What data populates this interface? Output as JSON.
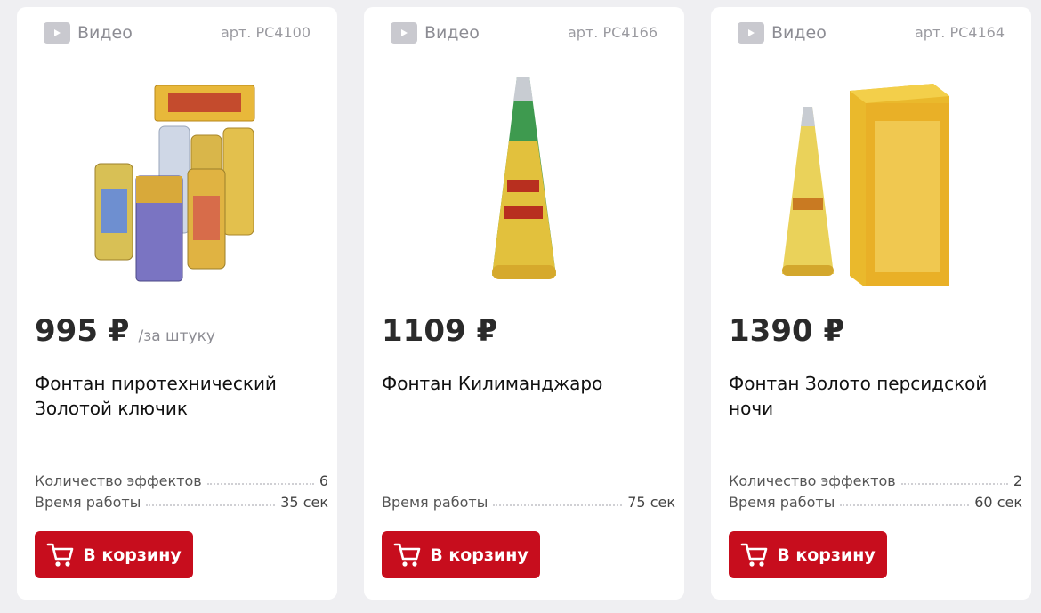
{
  "products": [
    {
      "video_label": "Видео",
      "sku": "арт. PC4100",
      "price": "995 ₽",
      "price_unit": "/за штуку",
      "title": "Фонтан пиротехнический Золотой ключик",
      "specs": [
        {
          "label": "Количество эффектов",
          "value": "6"
        },
        {
          "label": "Время работы",
          "value": "35 сек"
        }
      ],
      "cart_label": "В корзину"
    },
    {
      "video_label": "Видео",
      "sku": "арт. PC4166",
      "price": "1109 ₽",
      "title": "Фонтан Килиманджаро",
      "specs": [
        {
          "label": "Время работы",
          "value": "75 сек"
        }
      ],
      "cart_label": "В корзину"
    },
    {
      "video_label": "Видео",
      "sku": "арт. PC4164",
      "price": "1390 ₽",
      "title": "Фонтан Золото персидской ночи",
      "specs": [
        {
          "label": "Количество эффектов",
          "value": "2"
        },
        {
          "label": "Время работы",
          "value": "60 сек"
        }
      ],
      "cart_label": "В корзину"
    }
  ],
  "colors": {
    "accent": "#c70d1d",
    "background": "#efeff2",
    "card": "#ffffff"
  },
  "icons": [
    "play-icon",
    "cart-icon"
  ]
}
